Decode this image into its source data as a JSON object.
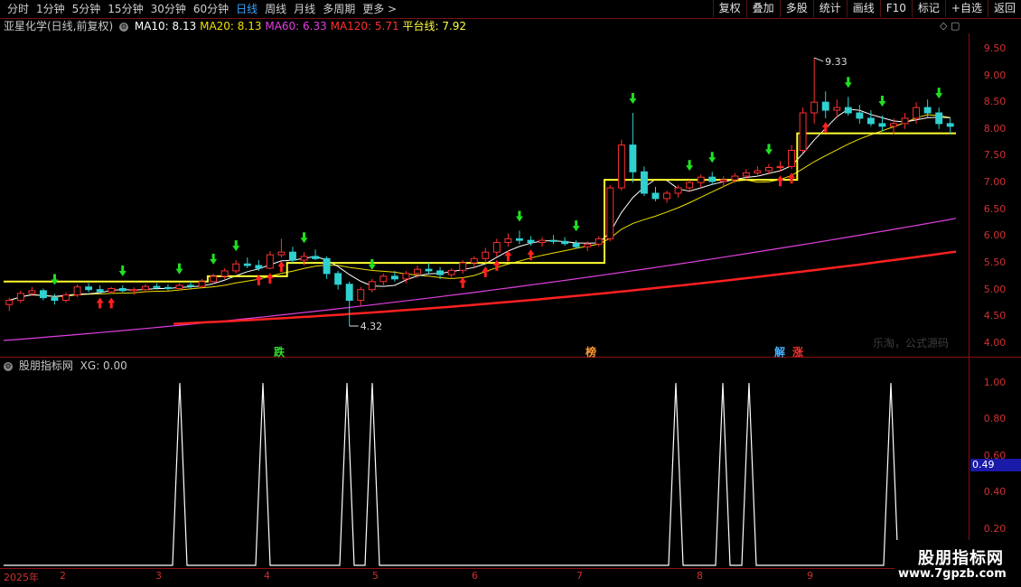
{
  "toolbar": {
    "left_tabs": [
      "分时",
      "1分钟",
      "5分钟",
      "15分钟",
      "30分钟",
      "60分钟",
      "日线",
      "周线",
      "月线",
      "多周期",
      "更多 >"
    ],
    "active_tab": "日线",
    "right_buttons": [
      "复权",
      "叠加",
      "多股",
      "统计",
      "画线",
      "F10",
      "标记",
      "+自选",
      "返回"
    ]
  },
  "info": {
    "title": "亚星化学(日线,前复权)",
    "ma10": "MA10: 8.13",
    "ma20": "MA20: 8.13",
    "ma60": "MA60: 6.33",
    "ma120": "MA120: 5.71",
    "platform": "平台线: 7.92"
  },
  "indicator": {
    "title": "股朋指标网",
    "xg": "XG: 0.00",
    "current_value": "0.49"
  },
  "price_axis": [
    "9.50",
    "9.00",
    "8.50",
    "8.00",
    "7.50",
    "7.00",
    "6.50",
    "6.00",
    "5.50",
    "5.00",
    "4.50",
    "4.00"
  ],
  "ind_axis": [
    "1.00",
    "0.80",
    "0.60",
    "0.40",
    "0.20"
  ],
  "dates": [
    "2025年",
    "2",
    "3",
    "4",
    "5",
    "6",
    "7",
    "8",
    "9"
  ],
  "annotations": {
    "high": "9.33",
    "low": "4.32"
  },
  "tags": [
    {
      "text": "跌",
      "color": "#30e030"
    },
    {
      "text": "榜",
      "color": "#ff9a30"
    },
    {
      "text": "解",
      "color": "#4ab0ff"
    },
    {
      "text": "涨",
      "color": "#ff3030"
    }
  ],
  "watermark": "乐淘，公式源码",
  "logo": {
    "name": "股朋指标网",
    "url": "www.7gpzb.com"
  },
  "colors": {
    "up": "#ff3030",
    "down": "#30d0d0",
    "ma10": "#ffffff",
    "ma20": "#f0e000",
    "ma60": "#e040e0",
    "ma120": "#ff2020",
    "platform": "#ffff30",
    "signal_up": "#ff2020",
    "signal_down": "#20e020",
    "grid": "#8a1010"
  },
  "chart_data": [
    {
      "type": "candlestick",
      "title": "亚星化学(日线,前复权)",
      "ylim": [
        4.0,
        9.7
      ],
      "ohlc_daily": [
        [
          4.72,
          4.85,
          4.6,
          4.8
        ],
        [
          4.8,
          4.98,
          4.75,
          4.93
        ],
        [
          4.93,
          5.05,
          4.88,
          4.98
        ],
        [
          4.98,
          5.02,
          4.8,
          4.85
        ],
        [
          4.85,
          4.92,
          4.72,
          4.8
        ],
        [
          4.8,
          4.95,
          4.76,
          4.9
        ],
        [
          4.9,
          5.1,
          4.86,
          5.05
        ],
        [
          5.05,
          5.12,
          4.95,
          5.0
        ],
        [
          5.0,
          5.08,
          4.92,
          4.96
        ],
        [
          4.96,
          5.05,
          4.92,
          5.02
        ],
        [
          5.02,
          5.08,
          4.95,
          4.98
        ],
        [
          4.98,
          5.04,
          4.9,
          5.0
        ],
        [
          5.0,
          5.1,
          4.96,
          5.06
        ],
        [
          5.06,
          5.12,
          5.0,
          5.04
        ],
        [
          5.04,
          5.1,
          4.98,
          5.02
        ],
        [
          5.02,
          5.12,
          4.98,
          5.08
        ],
        [
          5.08,
          5.15,
          5.02,
          5.06
        ],
        [
          5.06,
          5.2,
          5.02,
          5.15
        ],
        [
          5.15,
          5.3,
          5.1,
          5.25
        ],
        [
          5.25,
          5.4,
          5.2,
          5.35
        ],
        [
          5.35,
          5.55,
          5.3,
          5.48
        ],
        [
          5.48,
          5.6,
          5.4,
          5.45
        ],
        [
          5.45,
          5.55,
          5.35,
          5.4
        ],
        [
          5.4,
          5.72,
          5.38,
          5.65
        ],
        [
          5.65,
          5.95,
          5.6,
          5.7
        ],
        [
          5.7,
          5.8,
          5.5,
          5.55
        ],
        [
          5.55,
          5.7,
          5.45,
          5.62
        ],
        [
          5.62,
          5.75,
          5.55,
          5.58
        ],
        [
          5.58,
          5.62,
          5.2,
          5.3
        ],
        [
          5.3,
          5.35,
          5.0,
          5.1
        ],
        [
          5.1,
          5.15,
          4.32,
          4.8
        ],
        [
          4.8,
          5.05,
          4.7,
          5.0
        ],
        [
          5.0,
          5.2,
          4.95,
          5.15
        ],
        [
          5.15,
          5.3,
          5.08,
          5.25
        ],
        [
          5.25,
          5.35,
          5.15,
          5.2
        ],
        [
          5.2,
          5.35,
          5.12,
          5.3
        ],
        [
          5.3,
          5.45,
          5.22,
          5.38
        ],
        [
          5.38,
          5.5,
          5.3,
          5.35
        ],
        [
          5.35,
          5.42,
          5.2,
          5.28
        ],
        [
          5.28,
          5.4,
          5.2,
          5.36
        ],
        [
          5.36,
          5.55,
          5.3,
          5.5
        ],
        [
          5.5,
          5.62,
          5.42,
          5.58
        ],
        [
          5.58,
          5.78,
          5.5,
          5.7
        ],
        [
          5.7,
          5.95,
          5.62,
          5.88
        ],
        [
          5.88,
          6.05,
          5.8,
          5.95
        ],
        [
          5.95,
          6.1,
          5.85,
          5.92
        ],
        [
          5.92,
          6.0,
          5.82,
          5.88
        ],
        [
          5.88,
          5.98,
          5.8,
          5.92
        ],
        [
          5.92,
          6.02,
          5.85,
          5.9
        ],
        [
          5.9,
          5.98,
          5.82,
          5.86
        ],
        [
          5.86,
          5.92,
          5.76,
          5.8
        ],
        [
          5.8,
          5.9,
          5.72,
          5.85
        ],
        [
          5.85,
          6.0,
          5.8,
          5.95
        ],
        [
          5.95,
          6.95,
          5.9,
          6.9
        ],
        [
          6.9,
          7.8,
          6.85,
          7.7
        ],
        [
          7.7,
          8.3,
          7.0,
          7.2
        ],
        [
          7.2,
          7.3,
          6.75,
          6.8
        ],
        [
          6.8,
          6.92,
          6.65,
          6.7
        ],
        [
          6.7,
          6.85,
          6.62,
          6.8
        ],
        [
          6.8,
          6.95,
          6.72,
          6.9
        ],
        [
          6.9,
          7.05,
          6.82,
          7.0
        ],
        [
          7.0,
          7.15,
          6.9,
          7.1
        ],
        [
          7.1,
          7.2,
          6.95,
          7.02
        ],
        [
          7.02,
          7.12,
          6.92,
          7.05
        ],
        [
          7.05,
          7.18,
          7.0,
          7.12
        ],
        [
          7.12,
          7.25,
          7.05,
          7.18
        ],
        [
          7.18,
          7.3,
          7.1,
          7.22
        ],
        [
          7.22,
          7.35,
          7.15,
          7.28
        ],
        [
          7.28,
          7.4,
          7.2,
          7.3
        ],
        [
          7.3,
          7.7,
          7.25,
          7.6
        ],
        [
          7.6,
          8.4,
          7.55,
          8.3
        ],
        [
          8.3,
          9.33,
          8.1,
          8.5
        ],
        [
          8.5,
          8.7,
          8.2,
          8.35
        ],
        [
          8.35,
          8.55,
          8.2,
          8.4
        ],
        [
          8.4,
          8.6,
          8.25,
          8.3
        ],
        [
          8.3,
          8.45,
          8.1,
          8.2
        ],
        [
          8.2,
          8.35,
          8.05,
          8.1
        ],
        [
          8.1,
          8.25,
          7.95,
          8.05
        ],
        [
          8.05,
          8.2,
          7.9,
          8.1
        ],
        [
          8.1,
          8.3,
          8.0,
          8.2
        ],
        [
          8.2,
          8.5,
          8.1,
          8.4
        ],
        [
          8.4,
          8.55,
          8.2,
          8.3
        ],
        [
          8.3,
          8.4,
          8.0,
          8.1
        ],
        [
          8.1,
          8.2,
          7.9,
          8.05
        ]
      ],
      "ma60_endpoints": [
        [
          0,
          4.05
        ],
        [
          84,
          6.33
        ]
      ],
      "ma120_endpoints": [
        [
          0,
          4.25
        ],
        [
          84,
          5.71
        ]
      ],
      "platform_levels": [
        5.15,
        5.25,
        5.5,
        7.05,
        7.92
      ],
      "marked_high": 9.33,
      "marked_low": 4.32
    },
    {
      "type": "line",
      "title": "股朋指标网 XG",
      "ylim": [
        0,
        1.05
      ],
      "spike_dates_approx": [
        "2025-03-04",
        "2025-03-28",
        "2025-04-23",
        "2025-04-29",
        "2025-07-22",
        "2025-08-04",
        "2025-08-11",
        "2025-09-08"
      ],
      "spike_value": 1.0
    }
  ]
}
